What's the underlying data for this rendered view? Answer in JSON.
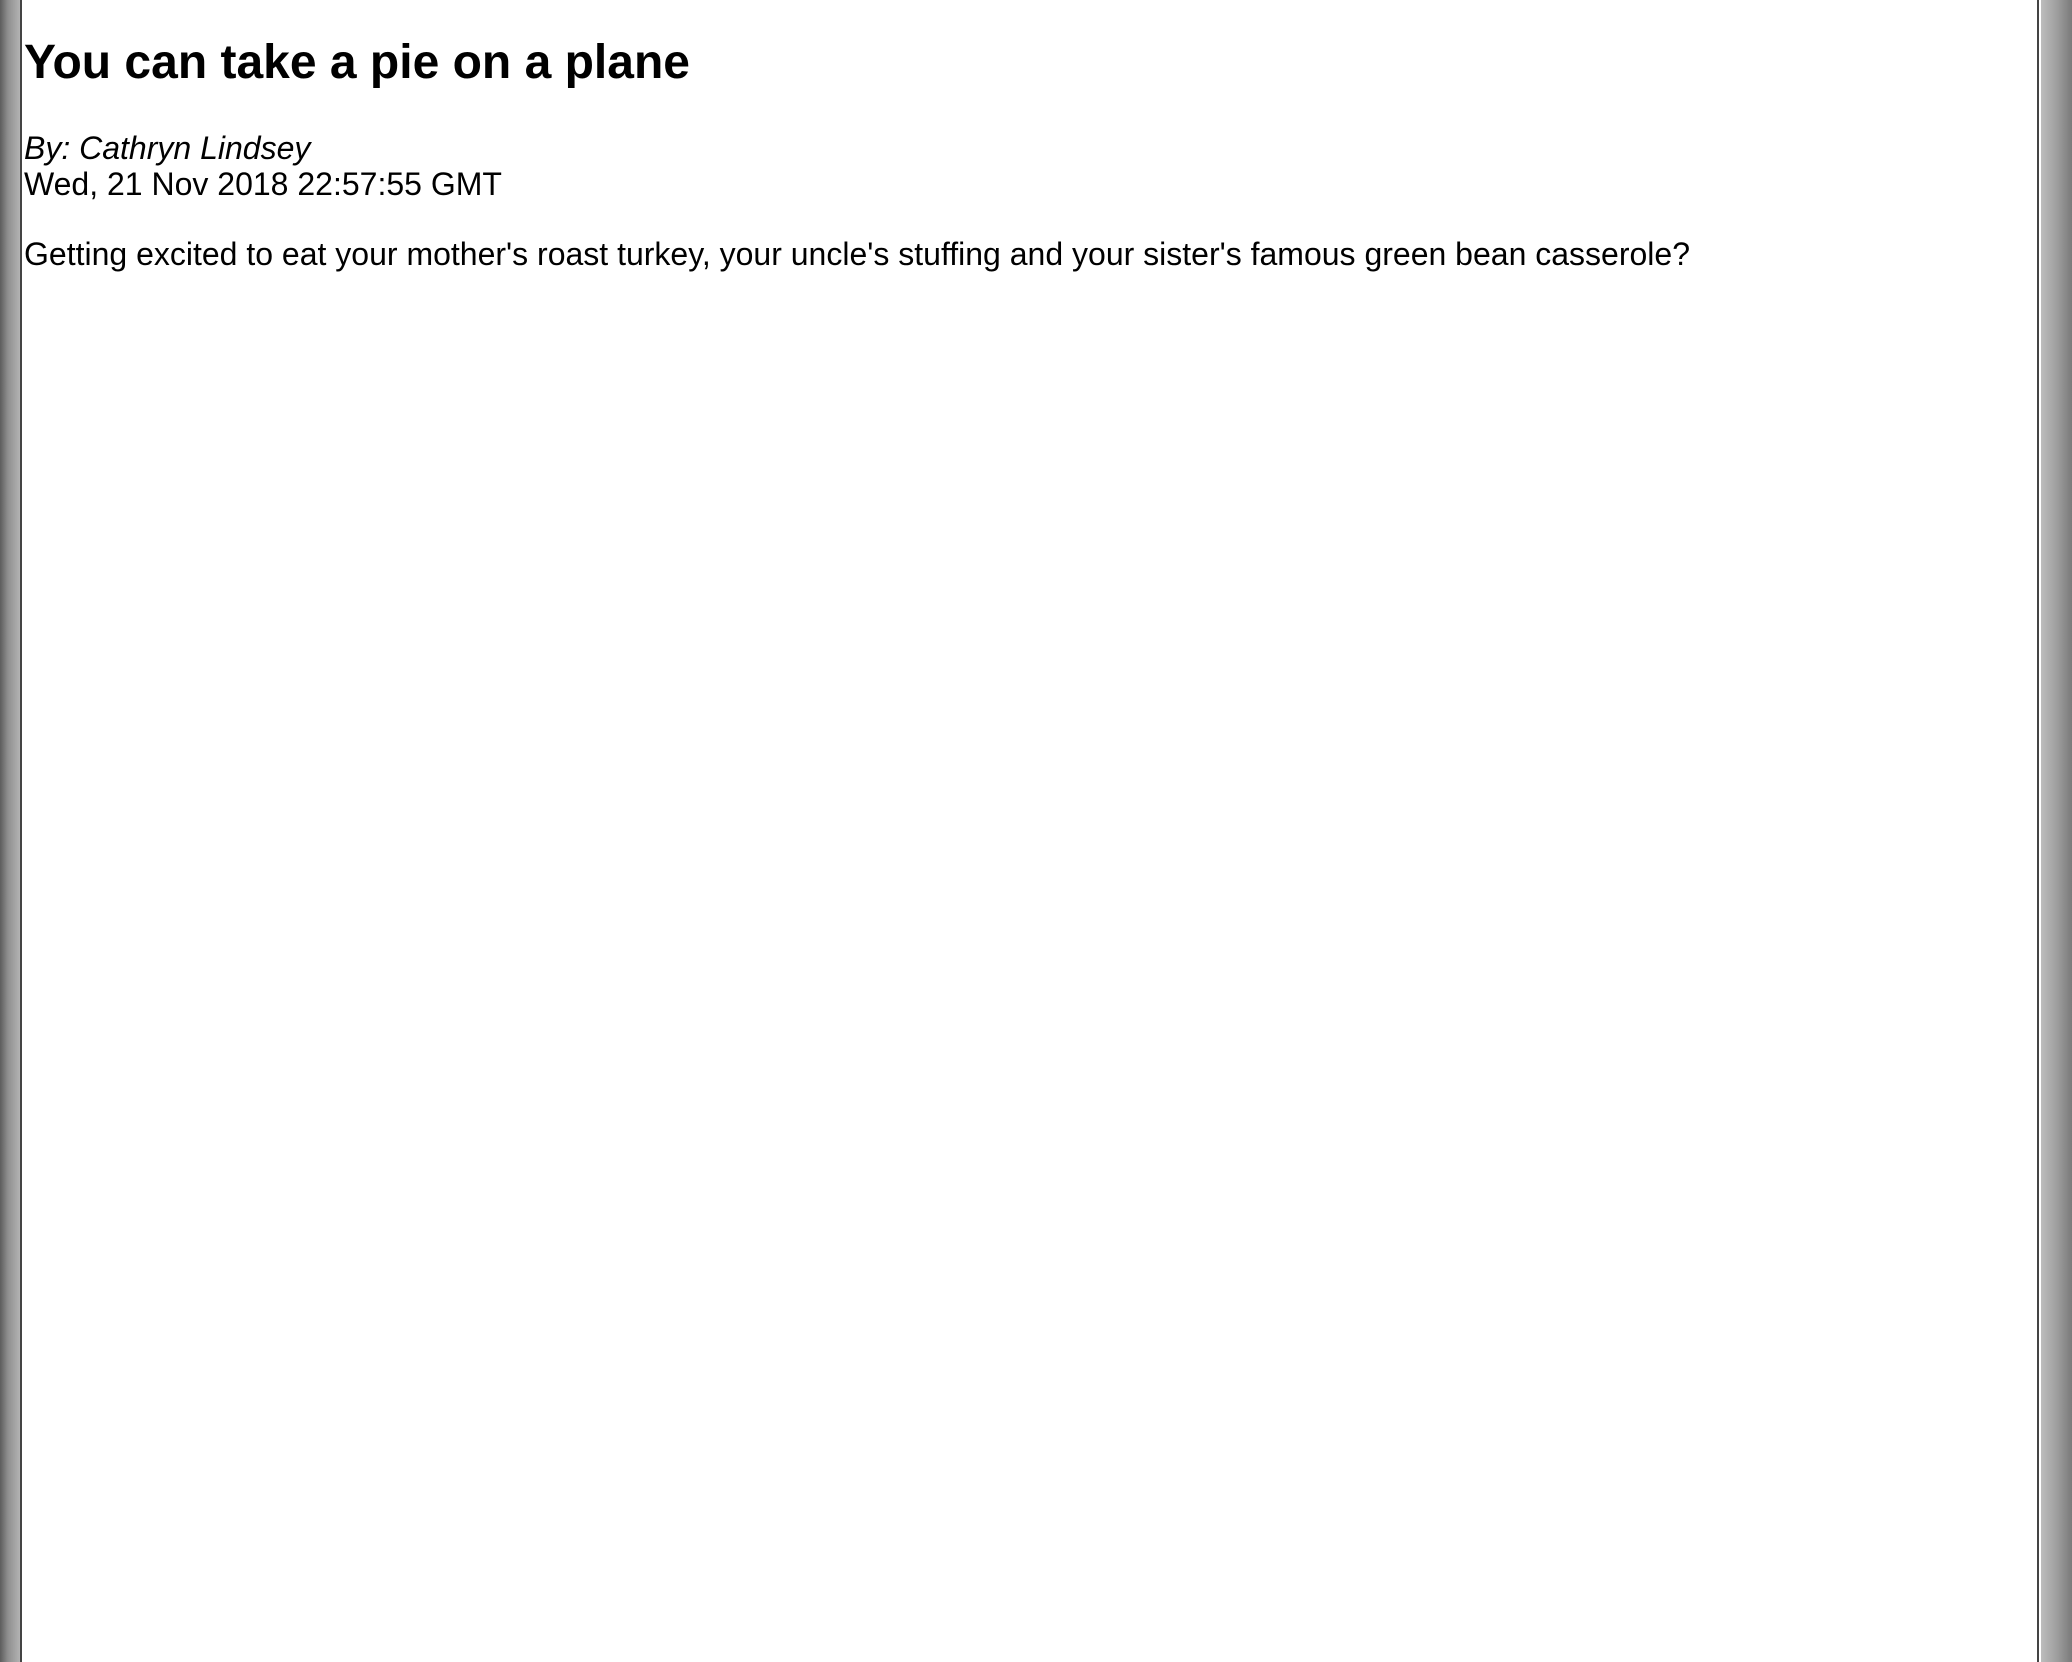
{
  "article": {
    "title": "You can take a pie on a plane",
    "byline": "By: Cathryn Lindsey",
    "date": "Wed, 21 Nov 2018 22:57:55 GMT",
    "summary": "Getting excited to eat your mother's roast turkey, your uncle's stuffing and your sister's famous green bean casserole?"
  }
}
